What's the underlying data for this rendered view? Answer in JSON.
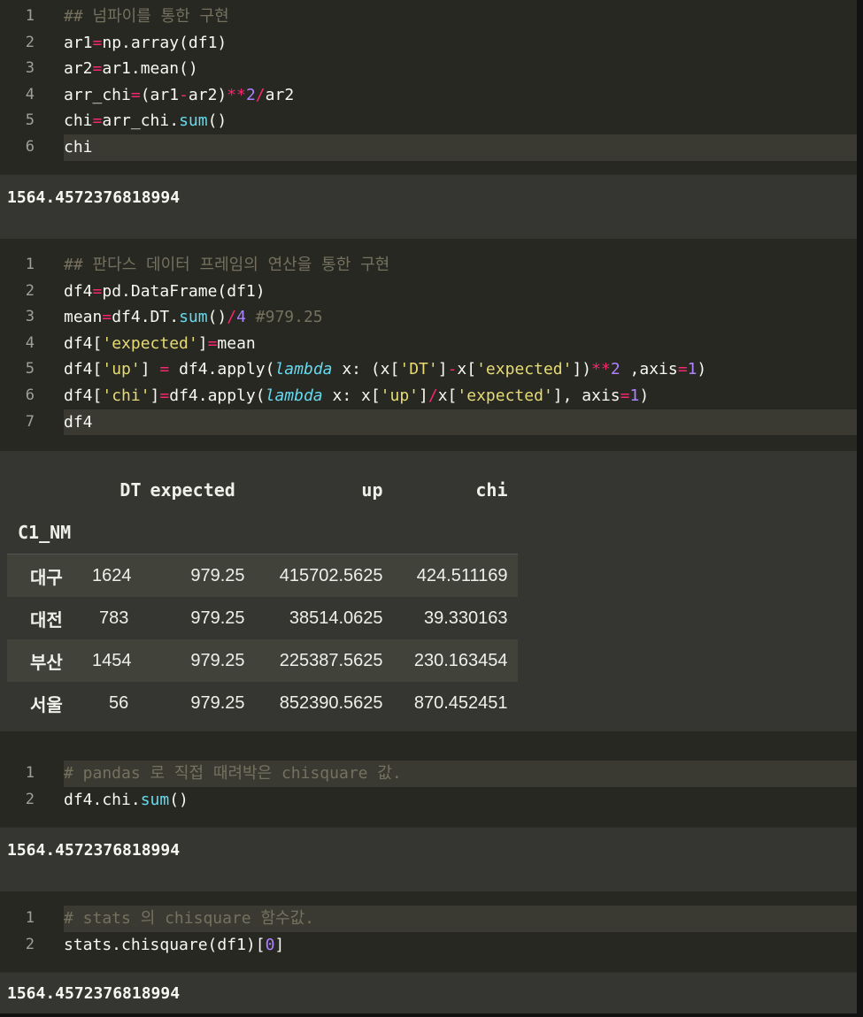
{
  "cells": [
    {
      "lines": [
        "1",
        "2",
        "3",
        "4",
        "5",
        "6"
      ],
      "code": {
        "l1_comment": "## 넘파이를 통한 구현",
        "l2_a": "ar1",
        "l2_b": "=",
        "l2_c": "np.array(df1)",
        "l3_a": "ar2",
        "l3_b": "=",
        "l3_c": "ar1.mean()",
        "l4_a": "arr_chi",
        "l4_b": "=",
        "l4_c": "(ar1",
        "l4_d": "-",
        "l4_e": "ar2)",
        "l4_f": "**",
        "l4_g": "2",
        "l4_h": "/",
        "l4_i": "ar2",
        "l5_a": "chi",
        "l5_b": "=",
        "l5_c": "arr_chi.",
        "l5_d": "sum",
        "l5_e": "()",
        "l6": "chi"
      },
      "output": "1564.4572376818994"
    },
    {
      "lines": [
        "1",
        "2",
        "3",
        "4",
        "5",
        "6",
        "7"
      ],
      "code": {
        "l1_comment": "## 판다스 데이터 프레임의 연산을 통한 구현",
        "l2_a": "df4",
        "l2_b": "=",
        "l2_c": "pd.DataFrame(df1)",
        "l3_a": "mean",
        "l3_b": "=",
        "l3_c": "df4.DT.",
        "l3_d": "sum",
        "l3_e": "()",
        "l3_f": "/",
        "l3_g": "4",
        "l3_h": " #979.25",
        "l4_a": "df4[",
        "l4_b": "'expected'",
        "l4_c": "]",
        "l4_d": "=",
        "l4_e": "mean",
        "l5_a": "df4[",
        "l5_b": "'up'",
        "l5_c": "] ",
        "l5_d": "=",
        "l5_e": " df4.apply(",
        "l5_f": "lambda",
        "l5_g": " x: (x[",
        "l5_h": "'DT'",
        "l5_i": "]",
        "l5_j": "-",
        "l5_k": "x[",
        "l5_l": "'expected'",
        "l5_m": "])",
        "l5_n": "**",
        "l5_o": "2",
        "l5_p": " ,axis",
        "l5_q": "=",
        "l5_r": "1",
        "l5_s": ")",
        "l6_a": "df4[",
        "l6_b": "'chi'",
        "l6_c": "]",
        "l6_d": "=",
        "l6_e": "df4.apply(",
        "l6_f": "lambda",
        "l6_g": " x: x[",
        "l6_h": "'up'",
        "l6_i": "]",
        "l6_j": "/",
        "l6_k": "x[",
        "l6_l": "'expected'",
        "l6_m": "], axis",
        "l6_n": "=",
        "l6_o": "1",
        "l6_p": ")",
        "l7": "df4"
      },
      "table": {
        "columns": [
          "DT",
          "expected",
          "up",
          "chi"
        ],
        "index_name": "C1_NM",
        "rows": [
          {
            "idx": "대구",
            "DT": "1624",
            "expected": "979.25",
            "up": "415702.5625",
            "chi": "424.511169"
          },
          {
            "idx": "대전",
            "DT": "783",
            "expected": "979.25",
            "up": "38514.0625",
            "chi": "39.330163"
          },
          {
            "idx": "부산",
            "DT": "1454",
            "expected": "979.25",
            "up": "225387.5625",
            "chi": "230.163454"
          },
          {
            "idx": "서울",
            "DT": "56",
            "expected": "979.25",
            "up": "852390.5625",
            "chi": "870.452451"
          }
        ]
      }
    },
    {
      "lines": [
        "1",
        "2"
      ],
      "code": {
        "l1_comment": "# pandas 로 직접 때려박은 chisquare 값.",
        "l2_a": "df4.chi.",
        "l2_b": "sum",
        "l2_c": "()"
      },
      "output": "1564.4572376818994"
    },
    {
      "lines": [
        "1",
        "2"
      ],
      "code": {
        "l1_comment": "# stats 의 chisquare 함수값.",
        "l2_a": "stats.chisquare(df1)[",
        "l2_b": "0",
        "l2_c": "]"
      },
      "output": "1564.4572376818994"
    }
  ]
}
